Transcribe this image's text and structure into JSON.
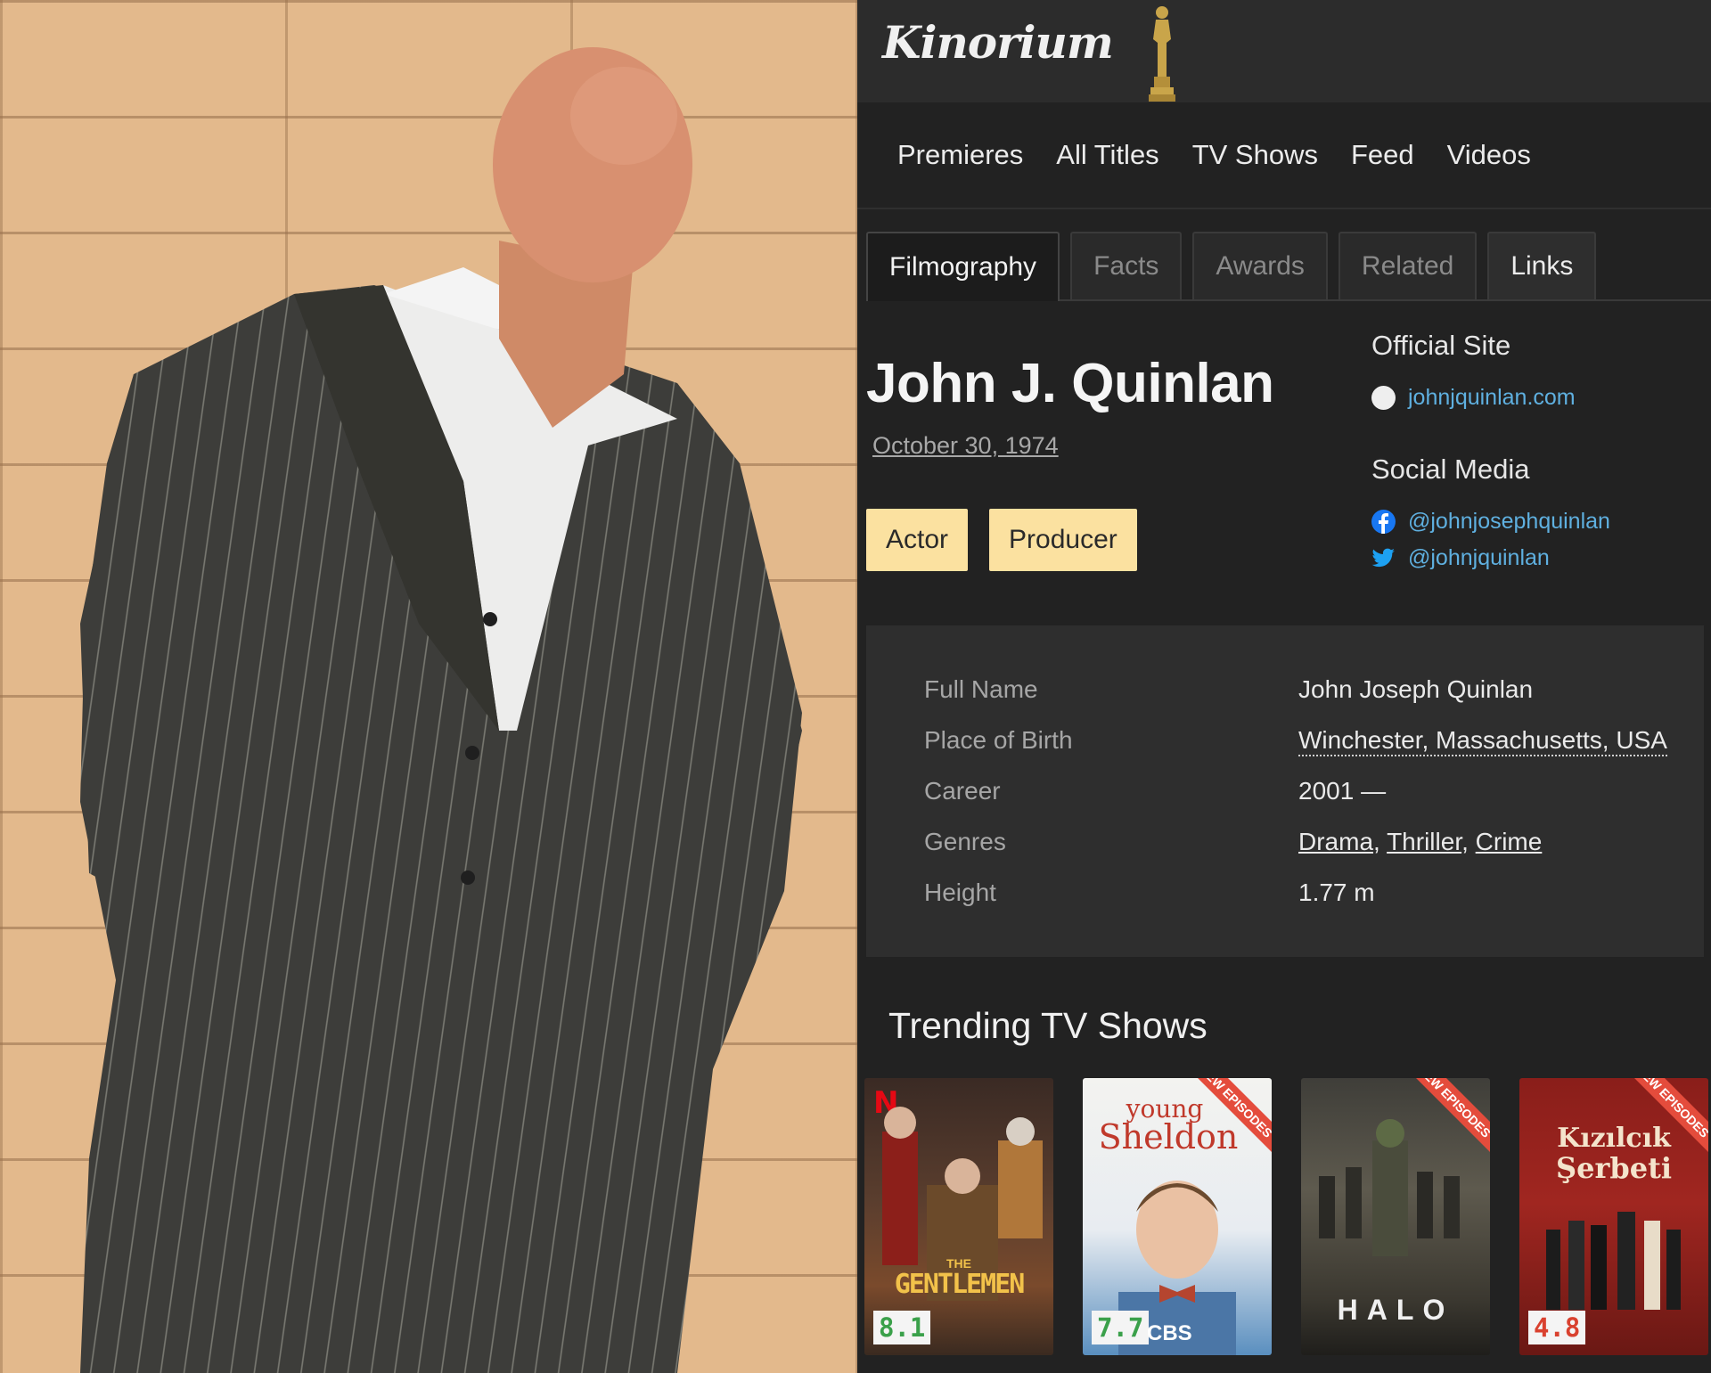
{
  "app": {
    "logo": "Kinorium",
    "logo_icon": "oscar-statuette-icon"
  },
  "nav": {
    "items": [
      "Premieres",
      "All Titles",
      "TV Shows",
      "Feed",
      "Videos"
    ]
  },
  "tabs": [
    {
      "label": "Filmography",
      "state": "active"
    },
    {
      "label": "Facts",
      "state": "disabled"
    },
    {
      "label": "Awards",
      "state": "disabled"
    },
    {
      "label": "Related",
      "state": "disabled"
    },
    {
      "label": "Links",
      "state": "enabled"
    }
  ],
  "person": {
    "name": "John J. Quinlan",
    "birth_date": "October 30, 1974",
    "roles": [
      "Actor",
      "Producer"
    ]
  },
  "official_site": {
    "heading": "Official Site",
    "url": "johnjquinlan.com"
  },
  "social_media": {
    "heading": "Social Media",
    "facebook": "@johnjosephquinlan",
    "twitter": "@johnjquinlan"
  },
  "info": {
    "full_name_label": "Full Name",
    "full_name": "John Joseph Quinlan",
    "birthplace_label": "Place of Birth",
    "birthplace": "Winchester, Massachusetts, USA",
    "career_label": "Career",
    "career": "2001 —",
    "genres_label": "Genres",
    "genres": [
      "Drama",
      "Thriller",
      "Crime"
    ],
    "height_label": "Height",
    "height": "1.77 m"
  },
  "trending": {
    "title": "Trending TV Shows",
    "shows": [
      {
        "title_line1": "THE",
        "title_line2": "GENTLEMEN",
        "rating": "8.1",
        "rating_color": "#3aa04a",
        "badge": "N",
        "new_episodes": false
      },
      {
        "title_line1": "young",
        "title_line2": "Sheldon",
        "rating": "7.7",
        "rating_color": "#3aa04a",
        "network": "CBS",
        "new_episodes": true
      },
      {
        "title_line1": "",
        "title_line2": "HALO",
        "new_episodes": true
      },
      {
        "title_line1": "Kızılcık",
        "title_line2": "Şerbeti",
        "rating": "4.8",
        "rating_color": "#d9412f",
        "new_episodes": true
      }
    ],
    "ribbon_text": "NEW EPISODES"
  },
  "colors": {
    "background": "#222222",
    "topbar": "#2c2c2c",
    "role_badge": "#fbe1a0",
    "link": "#5fb0e0"
  }
}
